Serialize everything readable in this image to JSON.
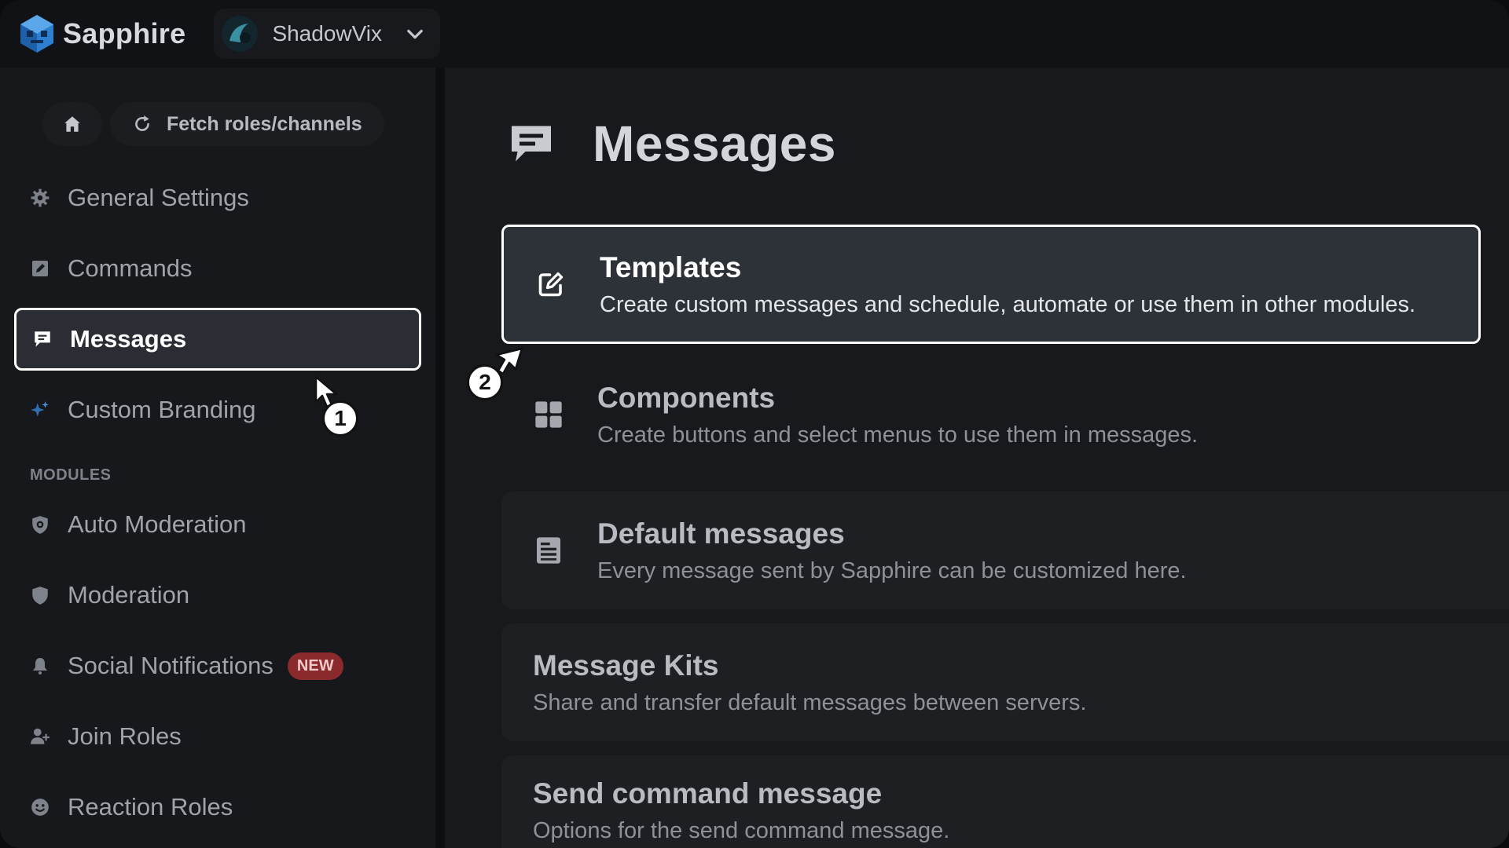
{
  "app": {
    "name": "Sapphire",
    "server": "ShadowVix"
  },
  "sidebar": {
    "home_label": "",
    "fetch_label": "Fetch roles/channels",
    "items": [
      {
        "label": "General Settings",
        "icon": "gear-icon"
      },
      {
        "label": "Commands",
        "icon": "edit-square-icon"
      },
      {
        "label": "Messages",
        "icon": "message-icon",
        "active": true
      },
      {
        "label": "Custom Branding",
        "icon": "sparkles-icon"
      }
    ],
    "modules_heading": "MODULES",
    "modules": [
      {
        "label": "Auto Moderation",
        "icon": "shield-cog-icon"
      },
      {
        "label": "Moderation",
        "icon": "shield-icon"
      },
      {
        "label": "Social Notifications",
        "icon": "bell-icon",
        "badge": "NEW"
      },
      {
        "label": "Join Roles",
        "icon": "user-plus-icon"
      },
      {
        "label": "Reaction Roles",
        "icon": "smiley-icon"
      }
    ]
  },
  "main": {
    "title": "Messages",
    "cards": [
      {
        "title": "Templates",
        "description": "Create custom messages and schedule, automate or use them in other modules.",
        "icon": "edit-icon",
        "highlighted": true
      },
      {
        "title": "Components",
        "description": "Create buttons and select menus to use them in messages.",
        "icon": "grid-icon"
      },
      {
        "title": "Default messages",
        "description": "Every message sent by Sapphire can be customized here.",
        "icon": "document-icon"
      },
      {
        "title": "Message Kits",
        "description": "Share and transfer default messages between servers."
      },
      {
        "title": "Send command message",
        "description": "Options for the send command message."
      }
    ]
  },
  "steps": [
    "1",
    "2"
  ],
  "colors": {
    "accent_logo": "#2f7fd0",
    "badge_bg": "#8b2a2d",
    "highlight_border": "#ffffff"
  }
}
